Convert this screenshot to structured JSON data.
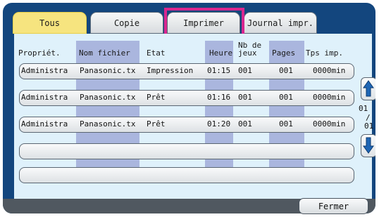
{
  "tabs": [
    {
      "label": "Tous",
      "active": true
    },
    {
      "label": "Copie",
      "active": false
    },
    {
      "label": "Imprimer",
      "active": false,
      "highlighted": true
    },
    {
      "label": "Journal impr.",
      "active": false
    }
  ],
  "columns": {
    "owner": "Propriét.",
    "filename": "Nom fichier",
    "status": "Etat",
    "time": "Heure",
    "sets": "Nb de\njeux",
    "pages": "Pages",
    "print_time": "Tps imp."
  },
  "rows": [
    {
      "owner": "Administra",
      "filename": "Panasonic.tx",
      "status": "Impression",
      "time": "01:15",
      "sets": "001",
      "pages": "001",
      "print_time": "0000min"
    },
    {
      "owner": "Administra",
      "filename": "Panasonic.tx",
      "status": "Prêt",
      "time": "01:16",
      "sets": "001",
      "pages": "001",
      "print_time": "0000min"
    },
    {
      "owner": "Administra",
      "filename": "Panasonic.tx",
      "status": "Prêt",
      "time": "01:20",
      "sets": "001",
      "pages": "001",
      "print_time": "0000min"
    }
  ],
  "pager": {
    "current": "01",
    "separator": "/",
    "total": "01"
  },
  "close_label": "Fermer",
  "colors": {
    "frame": "#13467e",
    "active_tab": "#f6e47f",
    "highlight": "#d9268f",
    "panel": "#dff1fb",
    "column_band": "#aab6de"
  },
  "icons": {
    "scroll_up": "up-arrow-icon",
    "scroll_down": "down-arrow-icon"
  }
}
